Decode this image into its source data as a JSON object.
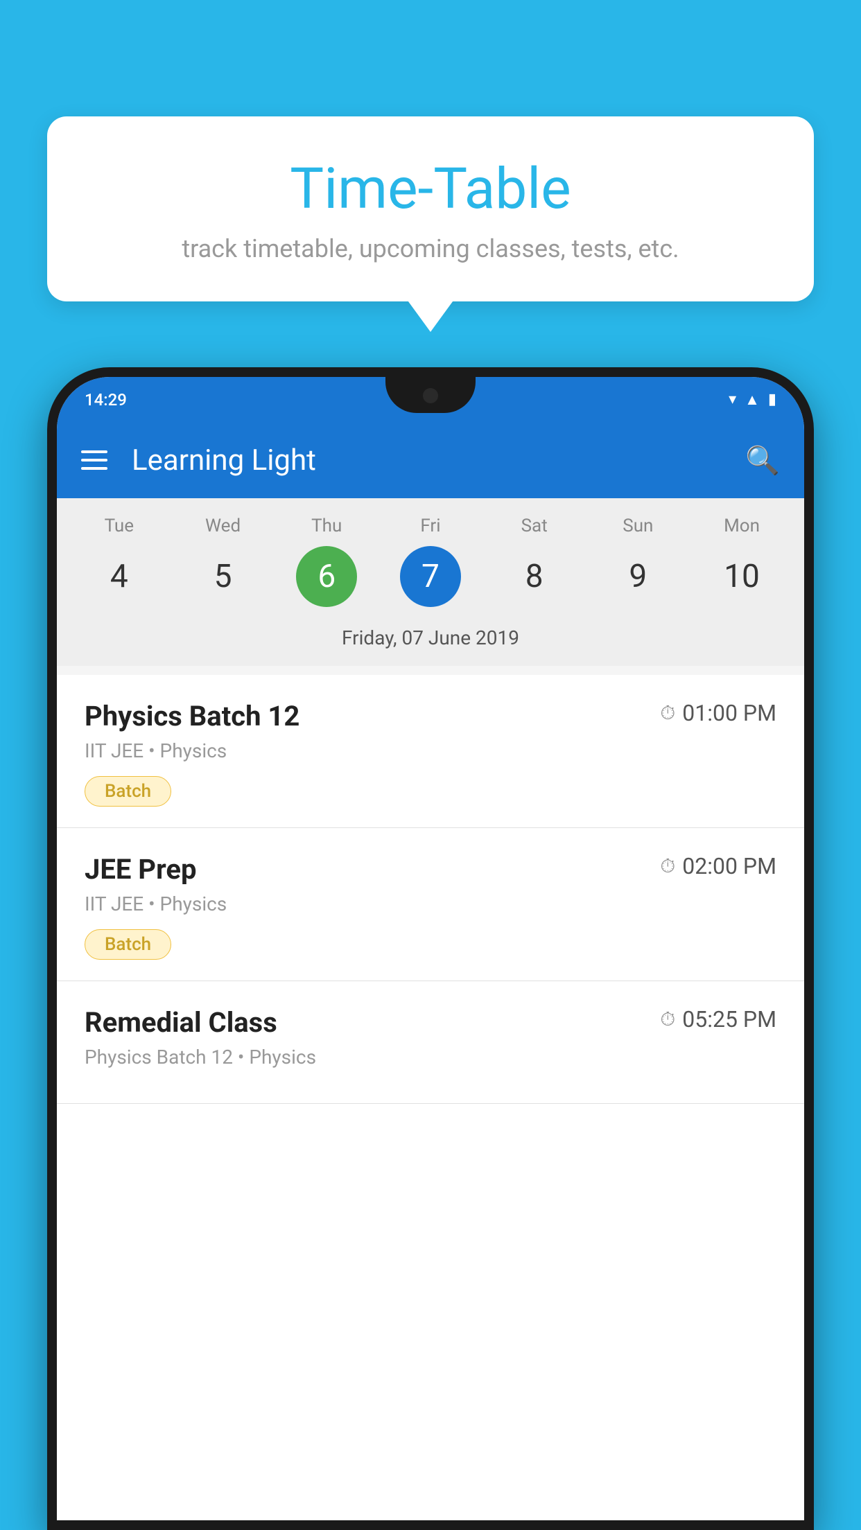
{
  "background": {
    "color": "#29B6E8"
  },
  "tooltip": {
    "title": "Time-Table",
    "subtitle": "track timetable, upcoming classes, tests, etc."
  },
  "phone": {
    "status_bar": {
      "time": "14:29"
    },
    "app_bar": {
      "title": "Learning Light"
    },
    "calendar": {
      "days": [
        {
          "label": "Tue",
          "num": "4",
          "state": "normal"
        },
        {
          "label": "Wed",
          "num": "5",
          "state": "normal"
        },
        {
          "label": "Thu",
          "num": "6",
          "state": "today"
        },
        {
          "label": "Fri",
          "num": "7",
          "state": "selected"
        },
        {
          "label": "Sat",
          "num": "8",
          "state": "normal"
        },
        {
          "label": "Sun",
          "num": "9",
          "state": "normal"
        },
        {
          "label": "Mon",
          "num": "10",
          "state": "normal"
        }
      ],
      "selected_date": "Friday, 07 June 2019"
    },
    "schedule": [
      {
        "title": "Physics Batch 12",
        "time": "01:00 PM",
        "subtitle": "IIT JEE • Physics",
        "badge": "Batch"
      },
      {
        "title": "JEE Prep",
        "time": "02:00 PM",
        "subtitle": "IIT JEE • Physics",
        "badge": "Batch"
      },
      {
        "title": "Remedial Class",
        "time": "05:25 PM",
        "subtitle": "Physics Batch 12 • Physics",
        "badge": ""
      }
    ]
  }
}
